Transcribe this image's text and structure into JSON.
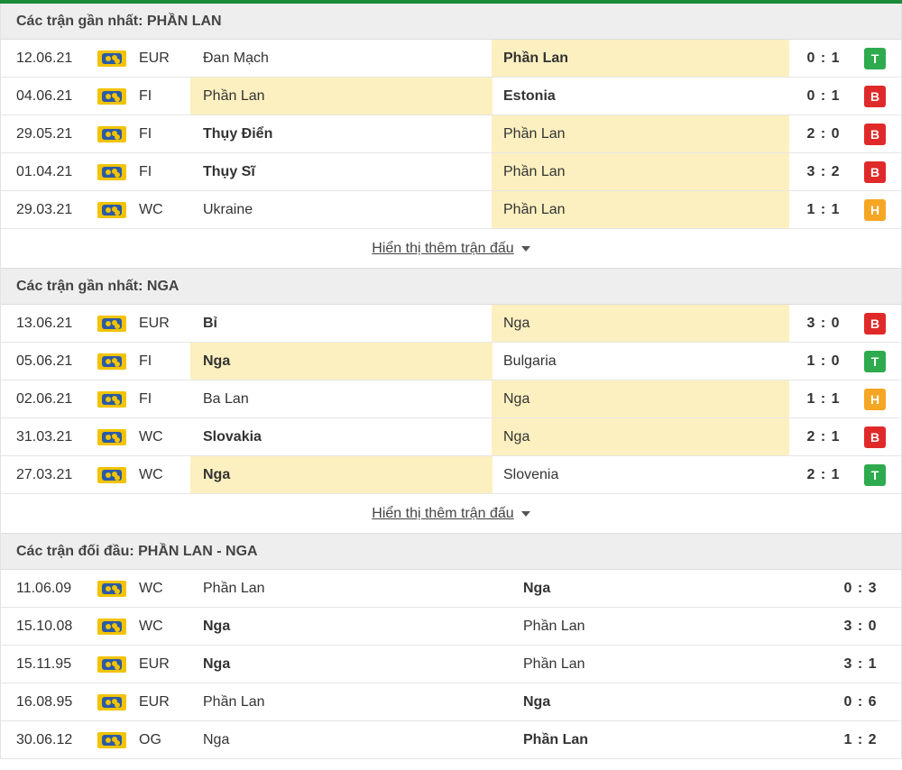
{
  "sections": [
    {
      "title": "Các trận gần nhất: PHẦN LAN",
      "more_label": "Hiển thị thêm trận đấu",
      "matches": [
        {
          "date": "12.06.21",
          "league": "EUR",
          "home": "Đan Mạch",
          "away": "Phần Lan",
          "score": "0 : 1",
          "result": "T",
          "home_bold": false,
          "away_bold": true,
          "hl": "away"
        },
        {
          "date": "04.06.21",
          "league": "FI",
          "home": "Phần Lan",
          "away": "Estonia",
          "score": "0 : 1",
          "result": "B",
          "home_bold": false,
          "away_bold": true,
          "hl": "home"
        },
        {
          "date": "29.05.21",
          "league": "FI",
          "home": "Thụy Điển",
          "away": "Phần Lan",
          "score": "2 : 0",
          "result": "B",
          "home_bold": true,
          "away_bold": false,
          "hl": "away"
        },
        {
          "date": "01.04.21",
          "league": "FI",
          "home": "Thụy Sĩ",
          "away": "Phần Lan",
          "score": "3 : 2",
          "result": "B",
          "home_bold": true,
          "away_bold": false,
          "hl": "away"
        },
        {
          "date": "29.03.21",
          "league": "WC",
          "home": "Ukraine",
          "away": "Phần Lan",
          "score": "1 : 1",
          "result": "H",
          "home_bold": false,
          "away_bold": false,
          "hl": "away"
        }
      ]
    },
    {
      "title": "Các trận gần nhất: NGA",
      "more_label": "Hiển thị thêm trận đấu",
      "matches": [
        {
          "date": "13.06.21",
          "league": "EUR",
          "home": "Bỉ",
          "away": "Nga",
          "score": "3 : 0",
          "result": "B",
          "home_bold": true,
          "away_bold": false,
          "hl": "away"
        },
        {
          "date": "05.06.21",
          "league": "FI",
          "home": "Nga",
          "away": "Bulgaria",
          "score": "1 : 0",
          "result": "T",
          "home_bold": true,
          "away_bold": false,
          "hl": "home"
        },
        {
          "date": "02.06.21",
          "league": "FI",
          "home": "Ba Lan",
          "away": "Nga",
          "score": "1 : 1",
          "result": "H",
          "home_bold": false,
          "away_bold": false,
          "hl": "away"
        },
        {
          "date": "31.03.21",
          "league": "WC",
          "home": "Slovakia",
          "away": "Nga",
          "score": "2 : 1",
          "result": "B",
          "home_bold": true,
          "away_bold": false,
          "hl": "away"
        },
        {
          "date": "27.03.21",
          "league": "WC",
          "home": "Nga",
          "away": "Slovenia",
          "score": "2 : 1",
          "result": "T",
          "home_bold": true,
          "away_bold": false,
          "hl": "home"
        }
      ]
    }
  ],
  "h2h": {
    "title": "Các trận đối đầu: PHẦN LAN - NGA",
    "matches": [
      {
        "date": "11.06.09",
        "league": "WC",
        "home": "Phần Lan",
        "away": "Nga",
        "score": "0 : 3",
        "home_bold": false,
        "away_bold": true
      },
      {
        "date": "15.10.08",
        "league": "WC",
        "home": "Nga",
        "away": "Phần Lan",
        "score": "3 : 0",
        "home_bold": true,
        "away_bold": false
      },
      {
        "date": "15.11.95",
        "league": "EUR",
        "home": "Nga",
        "away": "Phần Lan",
        "score": "3 : 1",
        "home_bold": true,
        "away_bold": false
      },
      {
        "date": "16.08.95",
        "league": "EUR",
        "home": "Phần Lan",
        "away": "Nga",
        "score": "0 : 6",
        "home_bold": false,
        "away_bold": true
      },
      {
        "date": "30.06.12",
        "league": "OG",
        "home": "Nga",
        "away": "Phần Lan",
        "score": "1 : 2",
        "home_bold": false,
        "away_bold": true
      }
    ]
  },
  "result_colors": {
    "T": "#2eab4e",
    "B": "#e02a2a",
    "H": "#f5a623"
  },
  "icons": {
    "league_flag": "world-map-flag-icon",
    "expand": "caret-down-icon"
  }
}
